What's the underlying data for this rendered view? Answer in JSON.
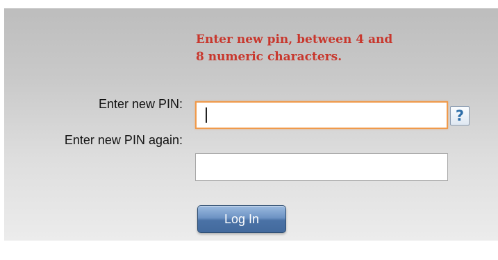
{
  "form": {
    "message": "Enter new pin, between 4 and 8 numeric characters.",
    "pin_label": "Enter new PIN:",
    "pin_again_label": "Enter new PIN again:",
    "pin_value": "",
    "pin_again_value": "",
    "help_label": "?",
    "login_label": "Log In"
  },
  "colors": {
    "message": "#c8372d",
    "focus_border": "#f09a4b",
    "button": "#4a72a6"
  },
  "icons": {
    "help": "question-mark-icon"
  }
}
